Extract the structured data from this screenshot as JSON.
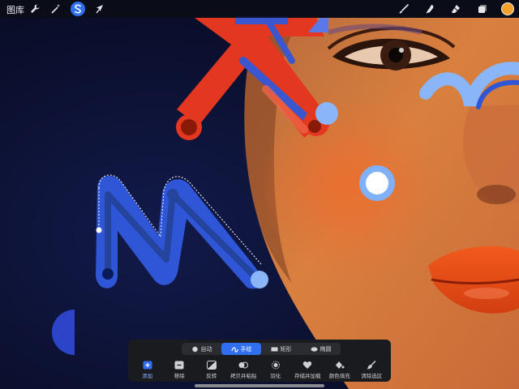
{
  "topbar": {
    "gallery_label": "图库",
    "left_tools": [
      {
        "icon": "wrench-icon",
        "name": "actions"
      },
      {
        "icon": "magic-wand-icon",
        "name": "adjustments"
      },
      {
        "icon": "selection-s-icon",
        "name": "selection",
        "active": true
      },
      {
        "icon": "arrow-cursor-icon",
        "name": "transform"
      }
    ],
    "right_tools": [
      {
        "icon": "brush-icon",
        "name": "paint"
      },
      {
        "icon": "smudge-icon",
        "name": "smudge"
      },
      {
        "icon": "eraser-icon",
        "name": "erase"
      },
      {
        "icon": "layers-icon",
        "name": "layers"
      }
    ],
    "color": "#f2a12b"
  },
  "selection_panel": {
    "modes": [
      {
        "label": "自动",
        "icon": "circle-icon"
      },
      {
        "label": "手绘",
        "icon": "freehand-icon",
        "active": true
      },
      {
        "label": "矩形",
        "icon": "rectangle-icon"
      },
      {
        "label": "椭圆",
        "icon": "ellipse-icon"
      }
    ],
    "actions": [
      {
        "label": "添加",
        "icon": "add-icon",
        "active": true
      },
      {
        "label": "移除",
        "icon": "remove-icon"
      },
      {
        "label": "反转",
        "icon": "invert-icon"
      },
      {
        "label": "拷贝并粘贴",
        "icon": "copy-paste-icon"
      },
      {
        "label": "羽化",
        "icon": "feather-icon"
      },
      {
        "label": "存储并加载",
        "icon": "heart-icon"
      },
      {
        "label": "颜色填充",
        "icon": "color-fill-icon"
      },
      {
        "label": "清除选区",
        "icon": "clear-brush-icon"
      }
    ]
  },
  "colors": {
    "accent": "#2f6ff0",
    "panel": "#1a1b1f",
    "shape_red": "#e4371f",
    "shape_blue": "#2e56d6",
    "shape_lightblue": "#8ab6f8"
  }
}
